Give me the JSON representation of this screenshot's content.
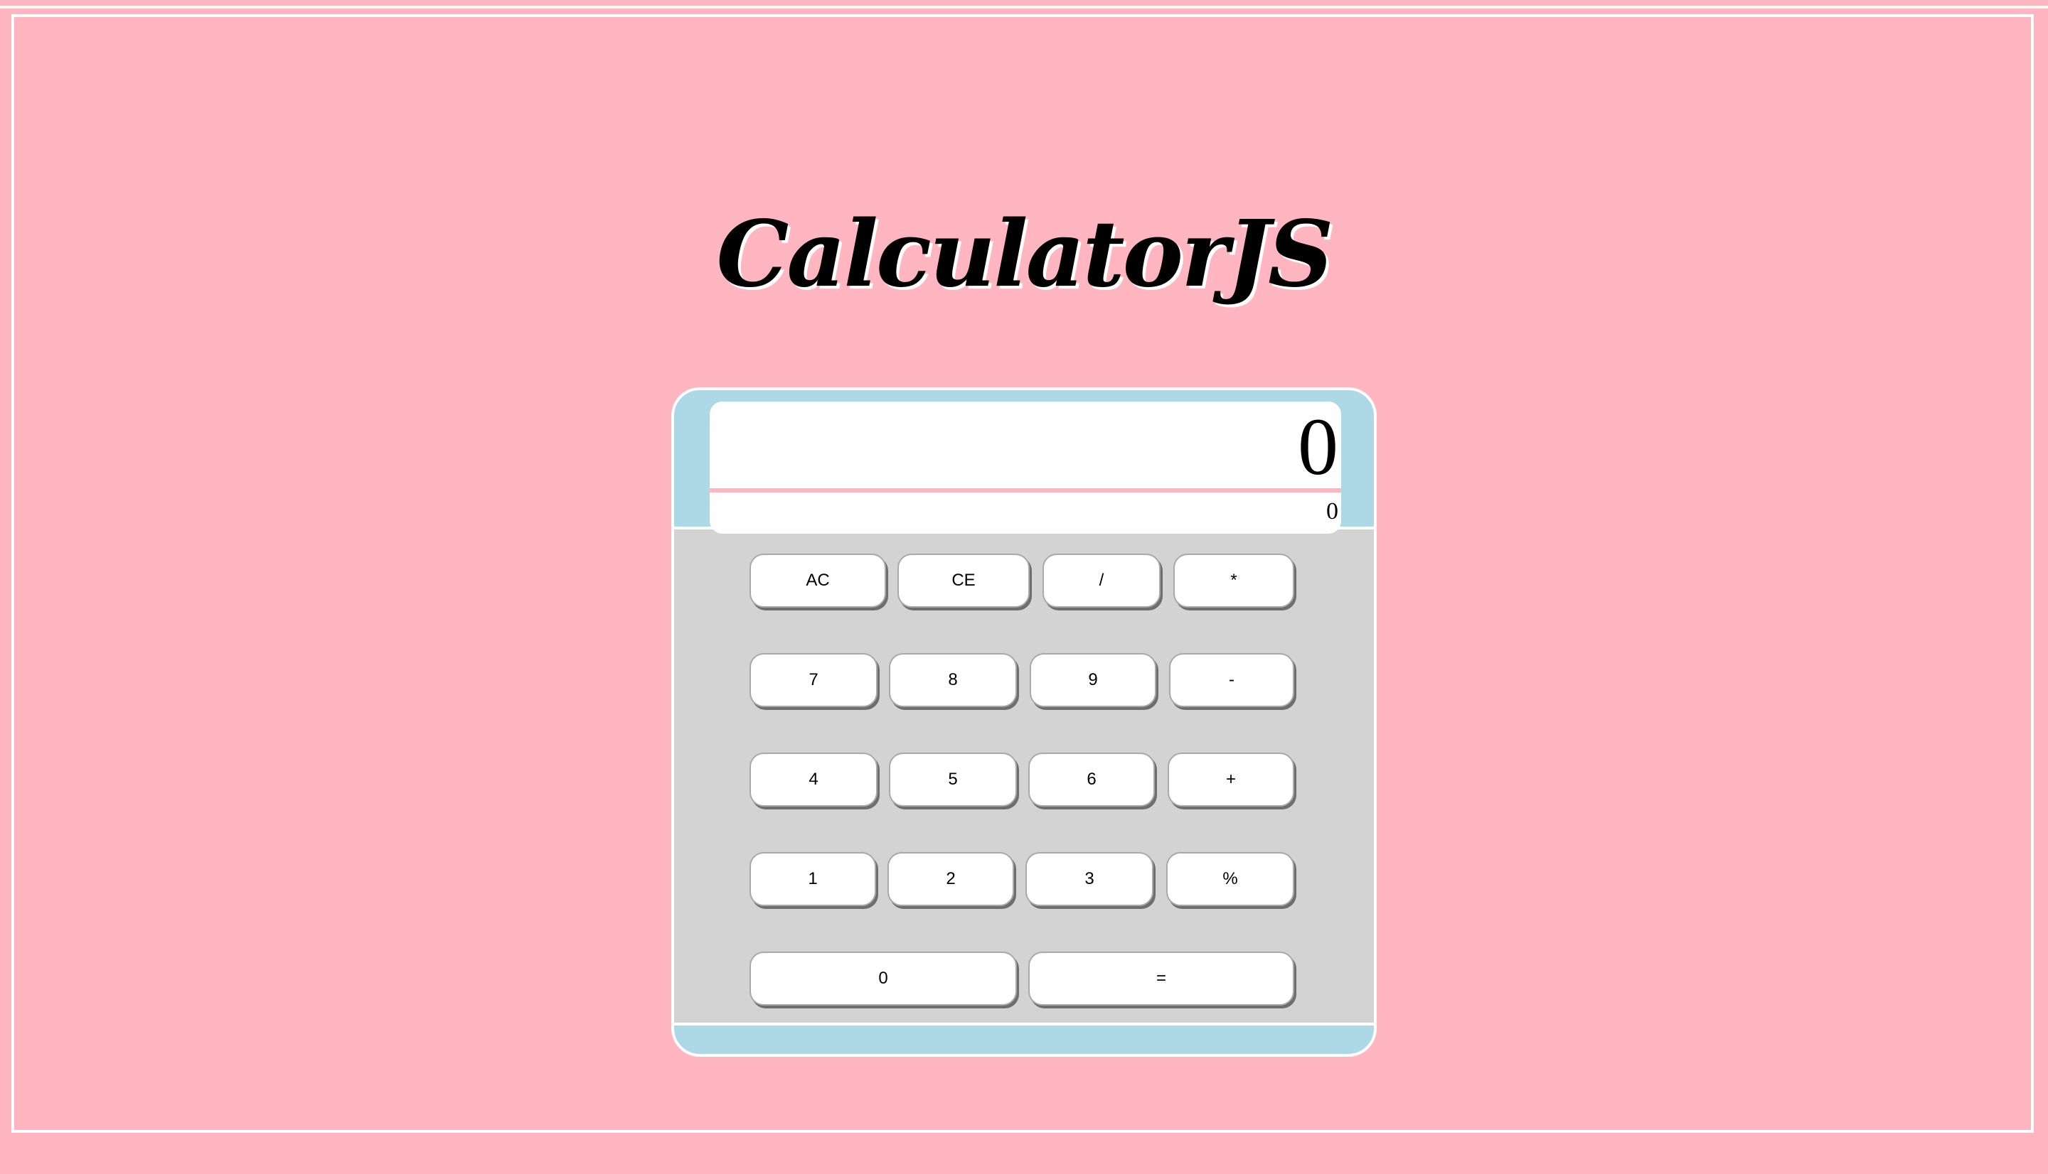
{
  "app": {
    "title": "CalculatorJS"
  },
  "display": {
    "current_value": "0",
    "previous_value": "0"
  },
  "keypad": {
    "rows": [
      [
        "AC",
        "CE",
        "/",
        "*"
      ],
      [
        "7",
        "8",
        "9",
        "-"
      ],
      [
        "4",
        "5",
        "6",
        "+"
      ],
      [
        "1",
        "2",
        "3",
        "%"
      ],
      [
        "0",
        "="
      ]
    ]
  },
  "colors": {
    "page_background": "#ffb6c1",
    "calculator_body": "#add8e6",
    "keypad_background": "#d3d3d3",
    "display_background": "#ffffff",
    "display_divider": "#ffb6c1",
    "key_background": "#ffffff",
    "frame_border": "#ffffff"
  }
}
